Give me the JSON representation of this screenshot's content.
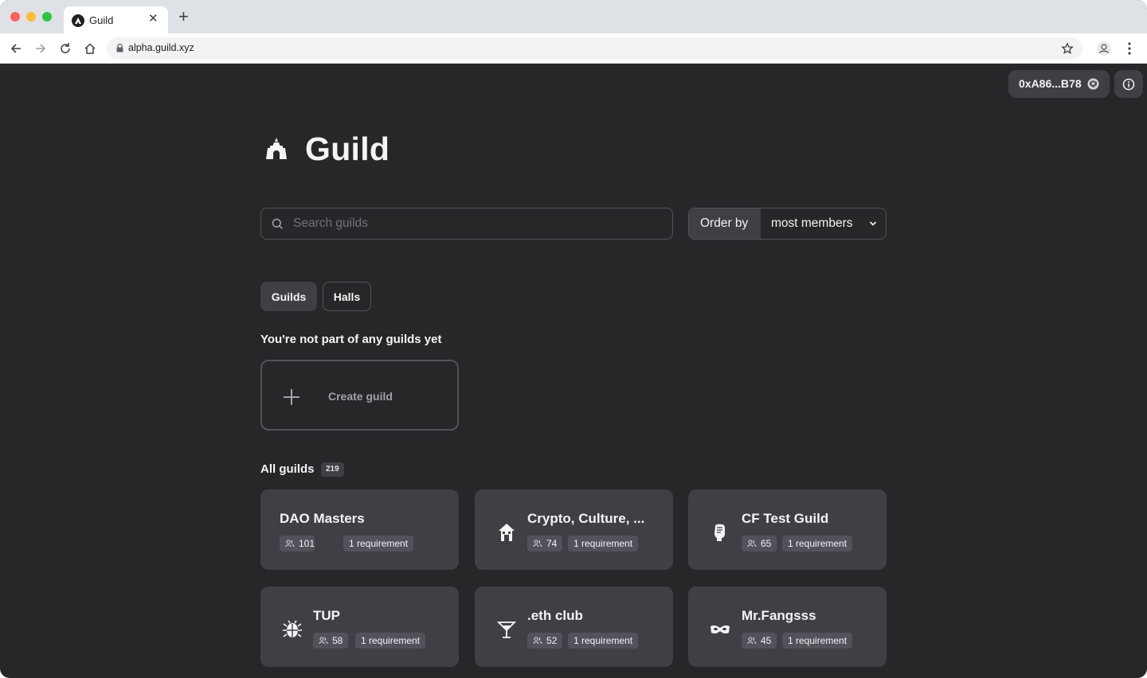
{
  "browser": {
    "tab_title": "Guild",
    "url": "alpha.guild.xyz"
  },
  "header": {
    "wallet_address": "0xA86...B78"
  },
  "page": {
    "title": "Guild"
  },
  "search": {
    "placeholder": "Search guilds"
  },
  "order": {
    "label": "Order by",
    "value": "most members"
  },
  "tabs": [
    {
      "label": "Guilds",
      "active": true
    },
    {
      "label": "Halls",
      "active": false
    }
  ],
  "my_guilds": {
    "empty_message": "You're not part of any guilds yet",
    "create_label": "Create guild"
  },
  "all_guilds": {
    "title": "All guilds",
    "count": "219",
    "items": [
      {
        "name": "DAO Masters",
        "members": "101",
        "requirements": "1 requirement",
        "icon": "none"
      },
      {
        "name": "Crypto, Culture, ...",
        "members": "74",
        "requirements": "1 requirement",
        "icon": "house-icon"
      },
      {
        "name": "CF Test Guild",
        "members": "65",
        "requirements": "1 requirement",
        "icon": "fist-icon"
      },
      {
        "name": "TUP",
        "members": "58",
        "requirements": "1 requirement",
        "icon": "bug-icon"
      },
      {
        "name": ".eth club",
        "members": "52",
        "requirements": "1 requirement",
        "icon": "cocktail-icon"
      },
      {
        "name": "Mr.Fangsss",
        "members": "45",
        "requirements": "1 requirement",
        "icon": "mask-icon"
      }
    ]
  }
}
